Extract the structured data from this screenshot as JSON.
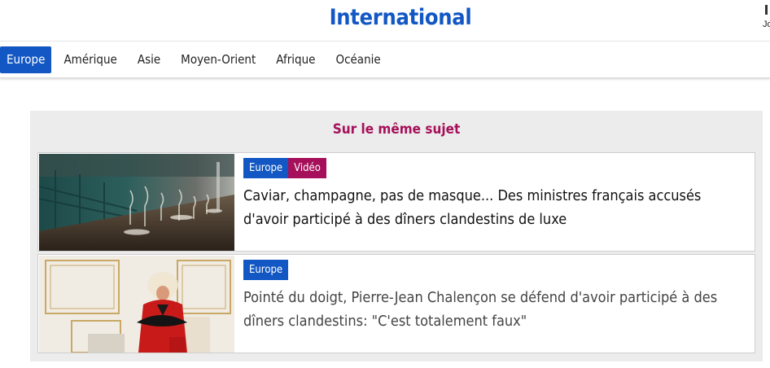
{
  "header": {
    "title": "International",
    "corner_text": "Jo"
  },
  "nav": {
    "tabs": [
      {
        "label": "Europe",
        "active": true
      },
      {
        "label": "Amérique",
        "active": false
      },
      {
        "label": "Asie",
        "active": false
      },
      {
        "label": "Moyen-Orient",
        "active": false
      },
      {
        "label": "Afrique",
        "active": false
      },
      {
        "label": "Océanie",
        "active": false
      }
    ]
  },
  "related": {
    "title": "Sur le même sujet",
    "articles": [
      {
        "tags": [
          "Europe",
          "Vidéo"
        ],
        "headline": "Caviar, champagne, pas de masque... Des ministres français accusés d'avoir participé à des dîners clandestins de luxe",
        "image": "restaurant-table-photo"
      },
      {
        "tags": [
          "Europe"
        ],
        "headline": "Pointé du doigt, Pierre-Jean Chalençon se défend d'avoir participé à des dîners clandestins: \"C'est totalement faux\"",
        "image": "man-in-red-suit-photo"
      }
    ]
  },
  "colors": {
    "brand_blue": "#1257c4",
    "accent_magenta": "#a6105a",
    "panel_gray": "#ececec"
  }
}
